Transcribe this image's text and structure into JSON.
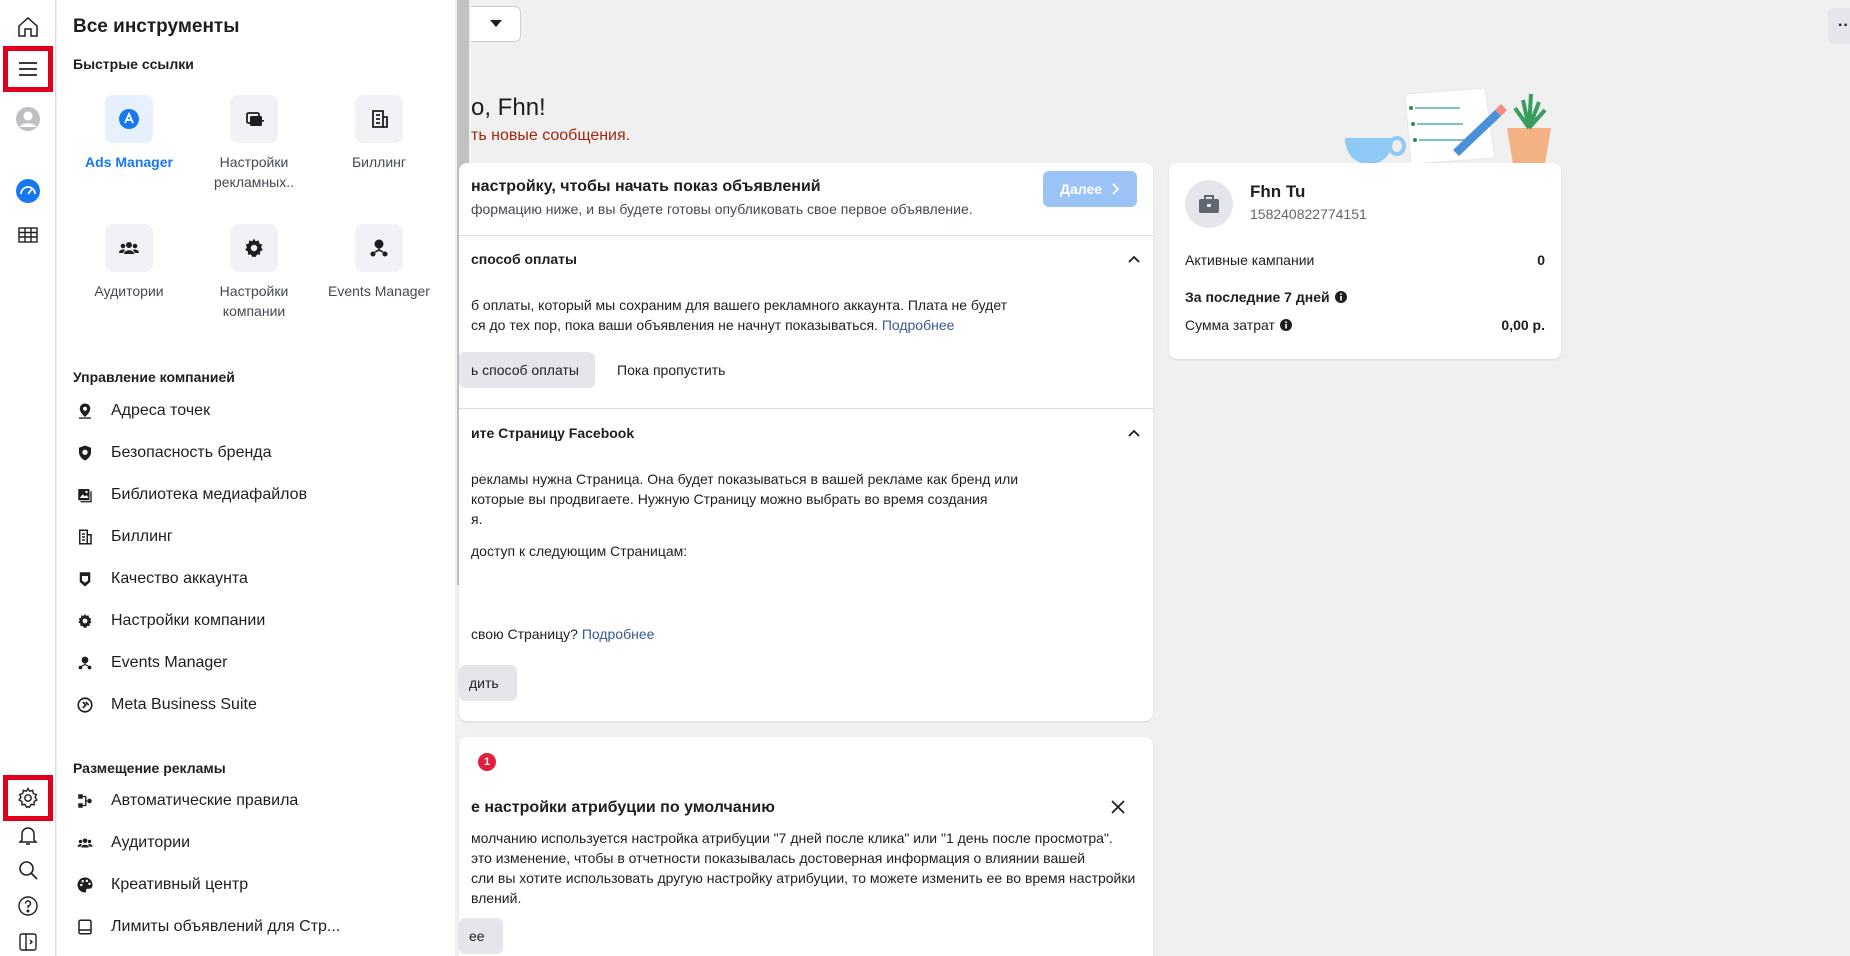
{
  "drawer": {
    "title": "Все инструменты",
    "quick_links_heading": "Быстрые ссылки",
    "quick_links": [
      {
        "label": "Ads Manager",
        "icon": "ads-manager-icon"
      },
      {
        "label": "Настройки рекламных..",
        "icon": "ad-account-settings-icon"
      },
      {
        "label": "Биллинг",
        "icon": "billing-icon"
      },
      {
        "label": "Аудитории",
        "icon": "audiences-icon"
      },
      {
        "label": "Настройки компании",
        "icon": "business-settings-icon"
      },
      {
        "label": "Events Manager",
        "icon": "events-manager-icon"
      }
    ],
    "section_manage": "Управление компанией",
    "manage_items": [
      {
        "label": "Адреса точек",
        "icon": "location-pin-icon"
      },
      {
        "label": "Безопасность бренда",
        "icon": "shield-icon"
      },
      {
        "label": "Библиотека медиафайлов",
        "icon": "media-library-icon"
      },
      {
        "label": "Биллинг",
        "icon": "billing-icon"
      },
      {
        "label": "Качество аккаунта",
        "icon": "account-quality-icon"
      },
      {
        "label": "Настройки компании",
        "icon": "gear-icon"
      },
      {
        "label": "Events Manager",
        "icon": "events-manager-icon"
      },
      {
        "label": "Meta Business Suite",
        "icon": "business-suite-icon"
      }
    ],
    "section_ads": "Размещение рекламы",
    "ads_items": [
      {
        "label": "Автоматические правила",
        "icon": "automated-rules-icon"
      },
      {
        "label": "Аудитории",
        "icon": "audiences-icon"
      },
      {
        "label": "Креативный центр",
        "icon": "palette-icon"
      },
      {
        "label": "Лимиты объявлений для Стр...",
        "icon": "ad-limits-icon"
      }
    ]
  },
  "main": {
    "greeting": "о, Fhn!",
    "greeting_sub": "ть новые сообщения.",
    "setup": {
      "title": "настройку, чтобы начать показ объявлений",
      "subtitle": "формацию ниже, и вы будете готовы опубликовать свое первое объявление.",
      "next_button": "Далее",
      "payment_title": "способ оплаты",
      "payment_text_1": "б оплаты, который мы сохраним для вашего рекламного аккаунта. Плата не будет",
      "payment_text_2": "ся до тех пор, пока ваши объявления не начнут показываться.",
      "learn_more": "Подробнее",
      "add_payment_button": "ь способ оплаты",
      "skip_button": "Пока пропустить",
      "page_title": "ите Страницу Facebook",
      "page_text_1": "рекламы нужна Страница. Она будет показываться в вашей рекламе как бренд или",
      "page_text_2": "которые вы продвигаете. Нужную Страницу можно выбрать во время создания",
      "page_text_3": "я.",
      "page_access": "доступ к следующим Страницам:",
      "page_question": "свою Страницу?",
      "page_learn_more": "Подробнее",
      "find_button": "дить"
    },
    "attribution": {
      "badge_count": "1",
      "title": "е настройки атрибуции по умолчанию",
      "text_1": "молчанию используется настройка атрибуции \"7 дней после клика\" или \"1 день после просмотра\".",
      "text_2": "это изменение, чтобы в отчетности показывалась достоверная информация о влиянии вашей",
      "text_3": "сли вы хотите использовать другую настройку атрибуции, то можете изменить ее во время настройки",
      "text_4": "влений.",
      "button": "ее"
    },
    "account": {
      "name": "Fhn Tu",
      "id": "158240822774151",
      "active_campaigns_label": "Активные кампании",
      "active_campaigns_value": "0",
      "last7_label": "За последние 7 дней",
      "spend_label": "Сумма затрат",
      "spend_value": "0,00 р."
    },
    "more_button": "··"
  },
  "colors": {
    "accent": "#1877f2",
    "highlight": "#e0001b",
    "badge": "#e41e3f",
    "disabled_primary": "#9cc3f5"
  }
}
